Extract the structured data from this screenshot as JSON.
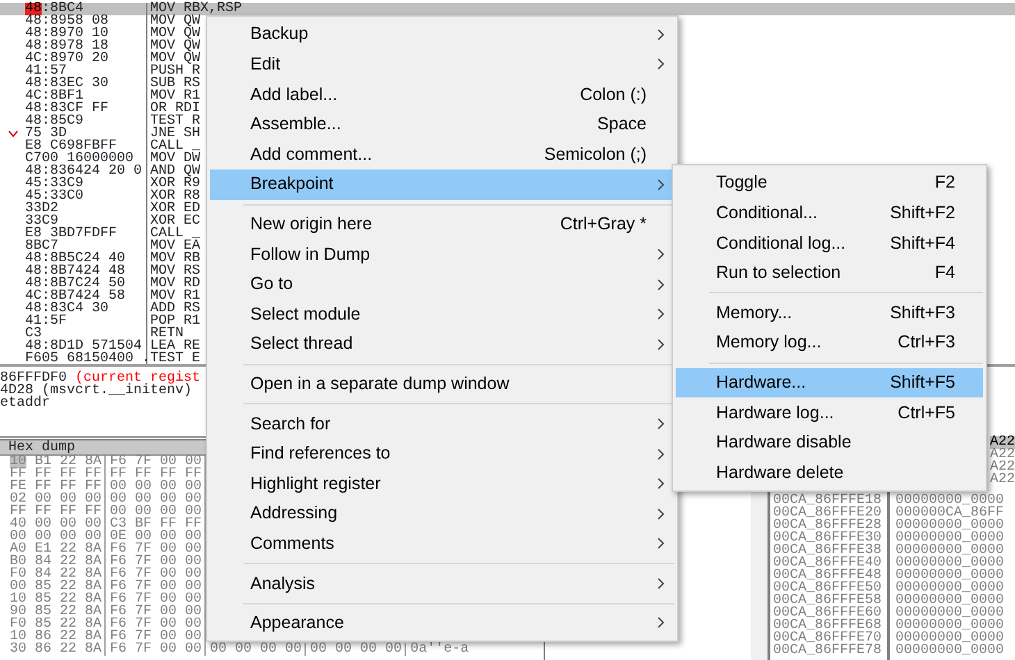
{
  "disassembly": {
    "rows": [
      {
        "highlight": "48",
        "bytes": ":8BC4",
        "command": "MOV RBX,RSP",
        "selected": true,
        "jump": false
      },
      {
        "bytes": "48:8958 08",
        "command": "MOV QW",
        "selected": false,
        "jump": false
      },
      {
        "bytes": "48:8970 10",
        "command": "MOV QW",
        "selected": false,
        "jump": false
      },
      {
        "bytes": "48:8978 18",
        "command": "MOV QW",
        "selected": false,
        "jump": false
      },
      {
        "bytes": "4C:8970 20",
        "command": "MOV QW",
        "selected": false,
        "jump": false
      },
      {
        "bytes": "41:57",
        "command": "PUSH R",
        "selected": false,
        "jump": false
      },
      {
        "bytes": "48:83EC 30",
        "command": "SUB RS",
        "selected": false,
        "jump": false
      },
      {
        "bytes": "4C:8BF1",
        "command": "MOV R1",
        "selected": false,
        "jump": false
      },
      {
        "bytes": "48:83CF FF",
        "command": "OR RDI",
        "selected": false,
        "jump": false
      },
      {
        "bytes": "48:85C9",
        "command": "TEST R",
        "selected": false,
        "jump": false
      },
      {
        "bytes": "75 3D",
        "command": "JNE SH",
        "selected": false,
        "jump": true
      },
      {
        "bytes": "E8 C698FBFF",
        "command": "CALL _",
        "selected": false,
        "jump": false
      },
      {
        "bytes": "C700 16000000",
        "command": "MOV DW",
        "selected": false,
        "jump": false
      },
      {
        "bytes": "48:836424 20 0",
        "command": "AND QW",
        "selected": false,
        "jump": false
      },
      {
        "bytes": "45:33C9",
        "command": "XOR R9",
        "selected": false,
        "jump": false
      },
      {
        "bytes": "45:33C0",
        "command": "XOR R8",
        "selected": false,
        "jump": false
      },
      {
        "bytes": "33D2",
        "command": "XOR ED",
        "selected": false,
        "jump": false
      },
      {
        "bytes": "33C9",
        "command": "XOR EC",
        "selected": false,
        "jump": false
      },
      {
        "bytes": "E8 3BD7FDFF",
        "command": "CALL _",
        "selected": false,
        "jump": false
      },
      {
        "bytes": "8BC7",
        "command": "MOV EA",
        "selected": false,
        "jump": false
      },
      {
        "bytes": "48:8B5C24 40",
        "command": "MOV RB",
        "selected": false,
        "jump": false
      },
      {
        "bytes": "48:8B7424 48",
        "command": "MOV RS",
        "selected": false,
        "jump": false
      },
      {
        "bytes": "48:8B7C24 50",
        "command": "MOV RD",
        "selected": false,
        "jump": false
      },
      {
        "bytes": "4C:8B7424 58",
        "command": "MOV R1",
        "selected": false,
        "jump": false
      },
      {
        "bytes": "48:83C4 30",
        "command": "ADD RS",
        "selected": false,
        "jump": false
      },
      {
        "bytes": "41:5F",
        "command": "POP R1",
        "selected": false,
        "jump": false
      },
      {
        "bytes": "C3",
        "command": "RETN",
        "selected": false,
        "jump": false
      },
      {
        "bytes": "48:8D1D 571504",
        "command": "LEA RE",
        "selected": false,
        "jump": false
      },
      {
        "bytes": "F605 68150400 .",
        "command": "TEST E",
        "selected": false,
        "jump": false
      }
    ]
  },
  "info": [
    {
      "text": "86FFFDF0",
      "comment": "(current regist"
    },
    {
      "text": "4D28 (msvcrt.__initenv)"
    },
    {
      "text": "etaddr"
    }
  ],
  "hex_dump": {
    "title": "Hex dump",
    "rows": [
      {
        "selected": true,
        "bytes": [
          "10",
          "B1",
          "22",
          "8A",
          "F6",
          "7F",
          "00",
          "00"
        ]
      },
      {
        "selected": false,
        "bytes": [
          "FF",
          "FF",
          "FF",
          "FF",
          "FF",
          "FF",
          "FF",
          "FF"
        ]
      },
      {
        "selected": false,
        "bytes": [
          "FE",
          "FF",
          "FF",
          "FF",
          "00",
          "00",
          "00",
          "00"
        ]
      },
      {
        "selected": false,
        "bytes": [
          "02",
          "00",
          "00",
          "00",
          "00",
          "00",
          "00",
          "00"
        ]
      },
      {
        "selected": false,
        "bytes": [
          "FF",
          "FF",
          "FF",
          "FF",
          "00",
          "00",
          "00",
          "00"
        ]
      },
      {
        "selected": false,
        "bytes": [
          "40",
          "00",
          "00",
          "00",
          "C3",
          "BF",
          "FF",
          "FF"
        ]
      },
      {
        "selected": false,
        "bytes": [
          "00",
          "00",
          "00",
          "00",
          "0E",
          "00",
          "00",
          "00"
        ]
      },
      {
        "selected": false,
        "bytes": [
          "A0",
          "E1",
          "22",
          "8A",
          "F6",
          "7F",
          "00",
          "00"
        ]
      },
      {
        "selected": false,
        "bytes": [
          "B0",
          "84",
          "22",
          "8A",
          "F6",
          "7F",
          "00",
          "00"
        ]
      },
      {
        "selected": false,
        "bytes": [
          "F0",
          "84",
          "22",
          "8A",
          "F6",
          "7F",
          "00",
          "00"
        ]
      },
      {
        "selected": false,
        "bytes": [
          "00",
          "85",
          "22",
          "8A",
          "F6",
          "7F",
          "00",
          "00"
        ]
      },
      {
        "selected": false,
        "bytes": [
          "10",
          "85",
          "22",
          "8A",
          "F6",
          "7F",
          "00",
          "00"
        ]
      },
      {
        "selected": false,
        "bytes": [
          "90",
          "85",
          "22",
          "8A",
          "F6",
          "7F",
          "00",
          "00"
        ]
      },
      {
        "selected": false,
        "bytes": [
          "F0",
          "85",
          "22",
          "8A",
          "F6",
          "7F",
          "00",
          "00"
        ]
      },
      {
        "selected": false,
        "bytes": [
          "10",
          "86",
          "22",
          "8A",
          "F6",
          "7F",
          "00",
          "00"
        ]
      },
      {
        "selected": false,
        "bytes": [
          "30",
          "86",
          "22",
          "8A",
          "F6",
          "7F",
          "00",
          "00",
          "00",
          "00",
          "00",
          "00",
          "00",
          "00",
          "00",
          "00"
        ],
        "ascii": "0a''e-a"
      }
    ]
  },
  "stack": {
    "top_values": [
      {
        "text": "A22",
        "selected": true
      },
      {
        "text": "A22",
        "selected": false
      },
      {
        "text": "A22",
        "selected": false
      },
      {
        "text": "A22",
        "selected": false
      }
    ],
    "rows": [
      {
        "address": "00CA_86FFFE18",
        "value": "00000000_0000"
      },
      {
        "address": "00CA_86FFFE20",
        "value": "000000CA_86FF"
      },
      {
        "address": "00CA_86FFFE28",
        "value": "00000000_0000"
      },
      {
        "address": "00CA_86FFFE30",
        "value": "00000000_0000"
      },
      {
        "address": "00CA_86FFFE38",
        "value": "00000000_0000"
      },
      {
        "address": "00CA_86FFFE40",
        "value": "00000000_0000"
      },
      {
        "address": "00CA_86FFFE48",
        "value": "00000000_0000"
      },
      {
        "address": "00CA_86FFFE50",
        "value": "00000000_0000"
      },
      {
        "address": "00CA_86FFFE58",
        "value": "00000000_0000"
      },
      {
        "address": "00CA_86FFFE60",
        "value": "00000000_0000"
      },
      {
        "address": "00CA_86FFFE68",
        "value": "00000000_0000"
      },
      {
        "address": "00CA_86FFFE70",
        "value": "00000000_0000"
      },
      {
        "address": "00CA_86FFFE78",
        "value": "00000000_0000"
      }
    ]
  },
  "context_menu": {
    "items": [
      {
        "kind": "item",
        "label": "Backup",
        "submenu": true,
        "selected": false
      },
      {
        "kind": "item",
        "label": "Edit",
        "submenu": true,
        "selected": false
      },
      {
        "kind": "item",
        "label": "Add label...",
        "shortcut": "Colon (:)",
        "submenu": false,
        "selected": false
      },
      {
        "kind": "item",
        "label": "Assemble...",
        "shortcut": "Space",
        "submenu": false,
        "selected": false
      },
      {
        "kind": "item",
        "label": "Add comment...",
        "shortcut": "Semicolon (;)",
        "submenu": false,
        "selected": false
      },
      {
        "kind": "item",
        "label": "Breakpoint",
        "submenu": true,
        "selected": true
      },
      {
        "kind": "separator"
      },
      {
        "kind": "item",
        "label": "New origin here",
        "shortcut": "Ctrl+Gray *",
        "submenu": false,
        "selected": false
      },
      {
        "kind": "item",
        "label": "Follow in Dump",
        "submenu": true,
        "selected": false
      },
      {
        "kind": "item",
        "label": "Go to",
        "submenu": true,
        "selected": false
      },
      {
        "kind": "item",
        "label": "Select module",
        "submenu": true,
        "selected": false
      },
      {
        "kind": "item",
        "label": "Select thread",
        "submenu": true,
        "selected": false
      },
      {
        "kind": "separator"
      },
      {
        "kind": "item",
        "label": "Open in a separate dump window",
        "submenu": false,
        "selected": false
      },
      {
        "kind": "separator"
      },
      {
        "kind": "item",
        "label": "Search for",
        "submenu": true,
        "selected": false
      },
      {
        "kind": "item",
        "label": "Find references to",
        "submenu": true,
        "selected": false
      },
      {
        "kind": "item",
        "label": "Highlight register",
        "submenu": true,
        "selected": false
      },
      {
        "kind": "item",
        "label": "Addressing",
        "submenu": true,
        "selected": false
      },
      {
        "kind": "item",
        "label": "Comments",
        "submenu": true,
        "selected": false
      },
      {
        "kind": "separator"
      },
      {
        "kind": "item",
        "label": "Analysis",
        "submenu": true,
        "selected": false
      },
      {
        "kind": "separator"
      },
      {
        "kind": "item",
        "label": "Appearance",
        "submenu": true,
        "selected": false
      }
    ]
  },
  "breakpoint_submenu": {
    "items": [
      {
        "kind": "item",
        "label": "Toggle",
        "shortcut": "F2",
        "selected": false
      },
      {
        "kind": "item",
        "label": "Conditional...",
        "shortcut": "Shift+F2",
        "selected": false
      },
      {
        "kind": "item",
        "label": "Conditional log...",
        "shortcut": "Shift+F4",
        "selected": false
      },
      {
        "kind": "item",
        "label": "Run to selection",
        "shortcut": "F4",
        "selected": false
      },
      {
        "kind": "separator"
      },
      {
        "kind": "item",
        "label": "Memory...",
        "shortcut": "Shift+F3",
        "selected": false
      },
      {
        "kind": "item",
        "label": "Memory log...",
        "shortcut": "Ctrl+F3",
        "selected": false
      },
      {
        "kind": "separator"
      },
      {
        "kind": "item",
        "label": "Hardware...",
        "shortcut": "Shift+F5",
        "selected": true
      },
      {
        "kind": "item",
        "label": "Hardware log...",
        "shortcut": "Ctrl+F5",
        "selected": false
      },
      {
        "kind": "item",
        "label": "Hardware disable",
        "selected": false
      },
      {
        "kind": "item",
        "label": "Hardware delete",
        "selected": false
      }
    ]
  }
}
